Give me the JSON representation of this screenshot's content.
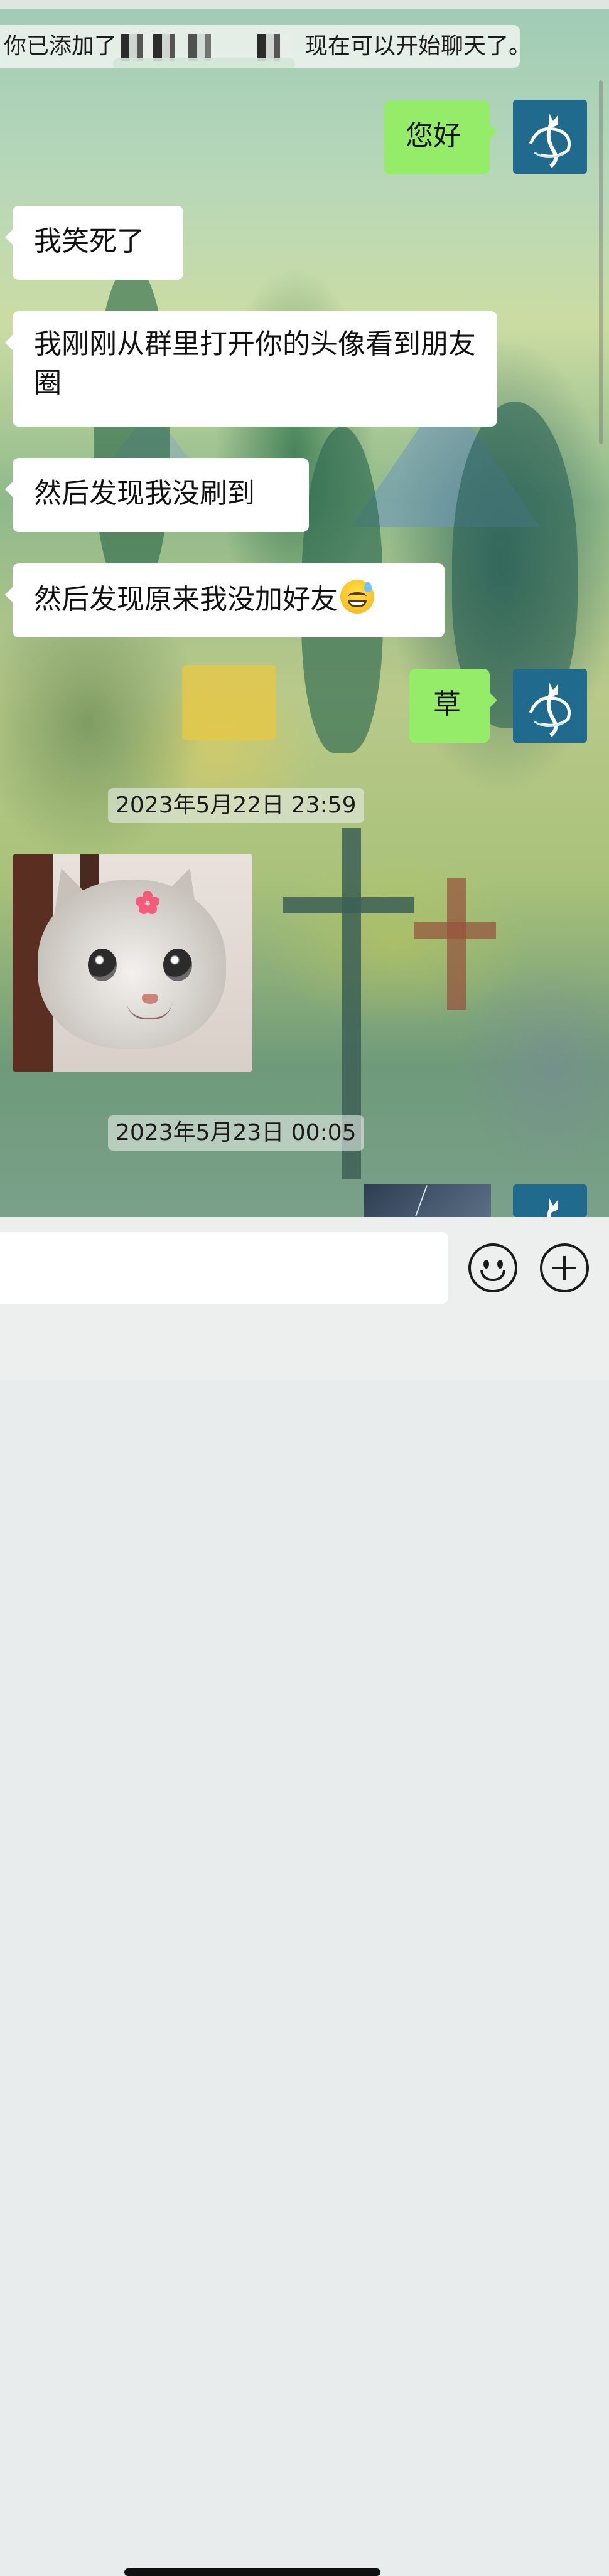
{
  "system_notice": {
    "prefix": "你已添加了",
    "suffix": "现在可以开始聊天了。"
  },
  "messages": [
    {
      "side": "right",
      "text": "您好"
    },
    {
      "side": "left",
      "text": "我笑死了"
    },
    {
      "side": "left",
      "text": "我刚刚从群里打开你的头像看到朋友圈"
    },
    {
      "side": "left",
      "text": "然后发现我没刷到"
    },
    {
      "side": "left",
      "text": "然后发现原来我没加好友",
      "emoji": "grinning-sweat-emoji"
    },
    {
      "side": "right",
      "text": "草"
    }
  ],
  "timestamps": [
    "2023年5月22日 23:59",
    "2023年5月23日 00:05"
  ],
  "image_message": {
    "description_icon": "cat-sticker",
    "side": "left"
  },
  "input": {
    "value": "",
    "placeholder": ""
  },
  "icons": {
    "emoji_button": "smiley-face-icon",
    "plus_button": "plus-circle-icon",
    "avatar": "cat-logo-avatar-icon"
  },
  "colors": {
    "outgoing_bubble": "#95ec69",
    "incoming_bubble": "#ffffff",
    "avatar_bg": "#1f6a8d"
  }
}
